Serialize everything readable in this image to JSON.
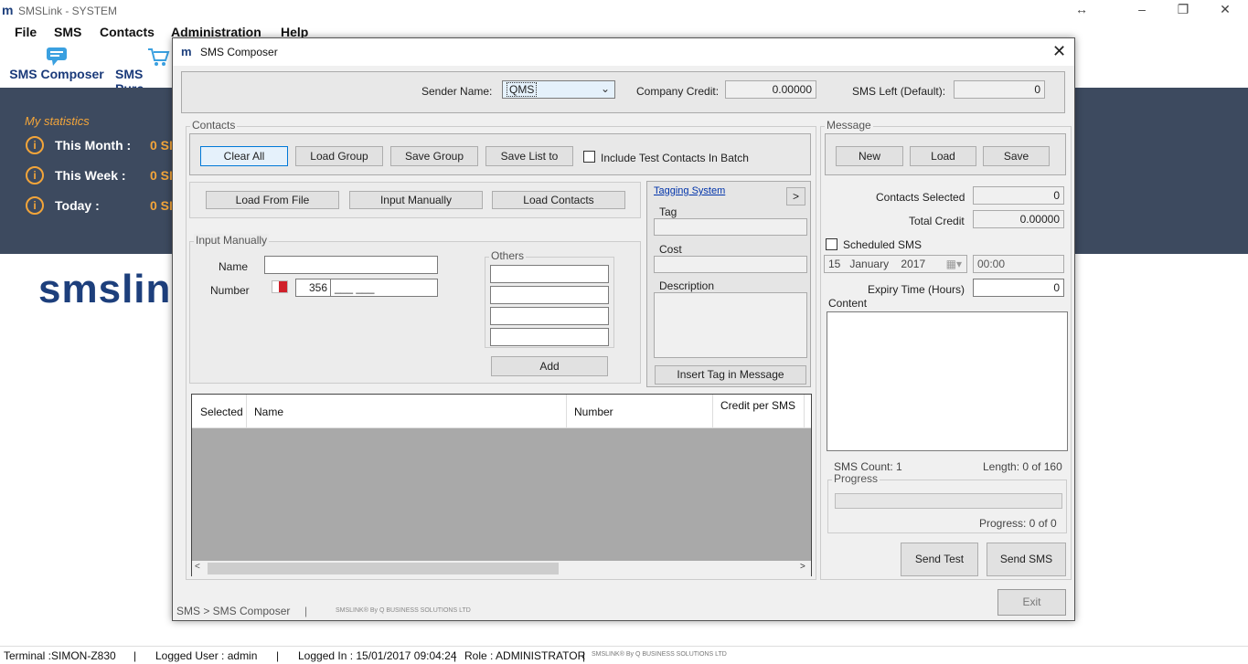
{
  "app": {
    "title": "SMSLink - SYSTEM"
  },
  "menu": [
    "File",
    "SMS",
    "Contacts",
    "Administration",
    "Help"
  ],
  "ribbon": {
    "composer": "SMS Composer",
    "purchase": "SMS Purc"
  },
  "stats": {
    "title": "My statistics",
    "rows": [
      {
        "label": "This Month :",
        "value": "0 SI"
      },
      {
        "label": "This Week :",
        "value": "0 SI"
      },
      {
        "label": "Today :",
        "value": "0 SI"
      }
    ]
  },
  "logo": "smslin",
  "statusbar": {
    "terminal": "Terminal :SIMON-Z830",
    "user": "Logged User : admin",
    "logged_in": "Logged In : 15/01/2017 09:04:24",
    "role": "Role : ADMINISTRATOR",
    "brand": "SMSLINK® By Q BUSINESS SOLUTIONS LTD",
    "sep": "|"
  },
  "dialog": {
    "title": "SMS Composer",
    "sender_label": "Sender Name:",
    "sender_value": "QMS",
    "company_credit_label": "Company Credit:",
    "company_credit": "0.00000",
    "sms_left_label": "SMS Left (Default):",
    "sms_left": "0",
    "contacts": {
      "title": "Contacts",
      "clear_all": "Clear All",
      "load_group": "Load Group",
      "save_group": "Save Group",
      "save_list": "Save List to",
      "include_test": "Include Test Contacts In Batch",
      "load_from_file": "Load From File",
      "input_manually": "Input Manually",
      "load_contacts": "Load Contacts",
      "input_manually_group": "Input Manually",
      "name_label": "Name",
      "number_label": "Number",
      "country_code": "356",
      "number_mask": "___ ___",
      "others_label": "Others",
      "add": "Add"
    },
    "tagging": {
      "title": "Tagging System",
      "expand": ">",
      "tag": "Tag",
      "cost": "Cost",
      "description": "Description",
      "insert": "Insert Tag in Message"
    },
    "grid": {
      "columns": [
        "Selected",
        "Name",
        "Number",
        "Credit per SMS"
      ]
    },
    "message": {
      "title": "Message",
      "new": "New",
      "load": "Load",
      "save": "Save",
      "contacts_selected_label": "Contacts Selected",
      "contacts_selected": "0",
      "total_credit_label": "Total Credit",
      "total_credit": "0.00000",
      "scheduled": "Scheduled SMS",
      "date_day": "15",
      "date_month": "January",
      "date_year": "2017",
      "time": "00:00",
      "expiry_label": "Expiry Time (Hours)",
      "expiry": "0",
      "content_label": "Content",
      "sms_count": "SMS Count: 1",
      "length": "Length: 0 of 160",
      "progress_label": "Progress",
      "progress_text": "Progress: 0 of 0",
      "progress_value": 0,
      "send_test": "Send Test",
      "send_sms": "Send SMS",
      "exit": "Exit"
    },
    "status": {
      "path": "SMS > SMS Composer",
      "sep": "|",
      "brand": "SMSLINK® By Q BUSINESS SOLUTIONS LTD"
    }
  }
}
